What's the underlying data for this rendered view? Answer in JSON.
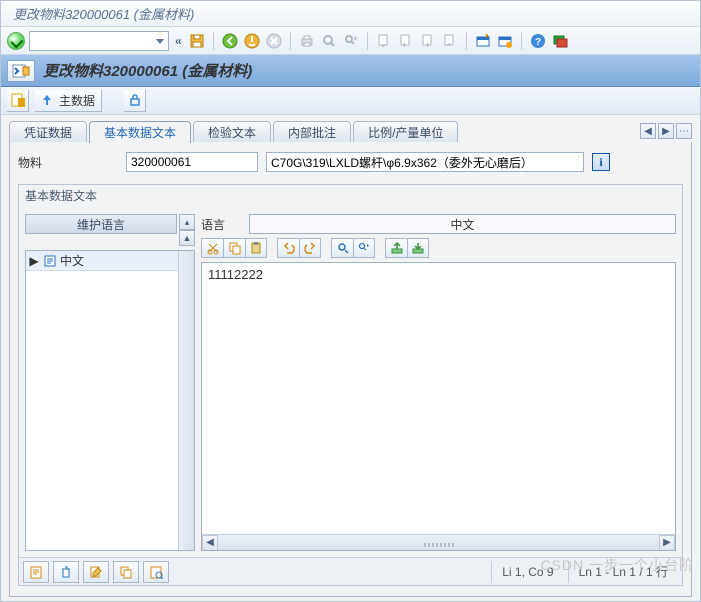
{
  "window": {
    "title": "更改物料320000061 (金属材料)"
  },
  "page": {
    "title": "更改物料320000061 (金属材料)"
  },
  "app_toolbar": {
    "main_data": "主数据"
  },
  "tabs": {
    "items": [
      {
        "label": "凭证数据"
      },
      {
        "label": "基本数据文本"
      },
      {
        "label": "检验文本"
      },
      {
        "label": "内部批注"
      },
      {
        "label": "比例/产量单位"
      }
    ]
  },
  "fields": {
    "material_label": "物料",
    "material_value": "320000061",
    "description": "C70G\\319\\LXLD螺杆\\φ6.9x362（委外无心磨后）"
  },
  "group": {
    "title": "基本数据文本"
  },
  "lang_panel": {
    "header": "维护语言",
    "selected": "中文"
  },
  "editor": {
    "lang_label": "语言",
    "lang_value": "中文",
    "text": "11112222"
  },
  "status": {
    "pos": "Li 1, Co 9",
    "ln": "Ln 1 - Ln 1 / 1 行"
  },
  "watermark": "CSDN 一步一个小台阶"
}
